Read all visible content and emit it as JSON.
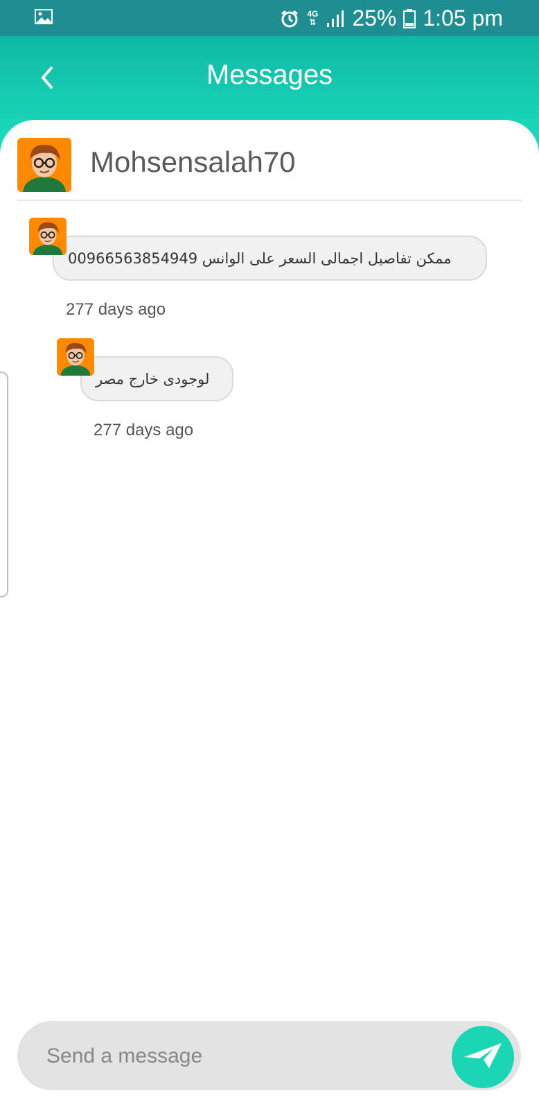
{
  "status_bar": {
    "battery": "25%",
    "time": "1:05 pm",
    "network": "4G",
    "icons": [
      "gallery-icon",
      "alarm-icon",
      "data-4g-icon",
      "signal-icon",
      "battery-icon"
    ]
  },
  "header": {
    "title": "Messages",
    "back_icon": "chevron-left-icon"
  },
  "contact": {
    "name": "Mohsensalah70"
  },
  "messages": [
    {
      "text": "ممكن تفاصيل  اجمالى السعر  على الوانس 00966563854949",
      "time": "277 days ago"
    },
    {
      "text": "لوجودى خارج مصر",
      "time": "277 days ago"
    }
  ],
  "composer": {
    "placeholder": "Send a message",
    "send_icon": "paper-plane-icon"
  },
  "colors": {
    "status_bar": "#1f8e92",
    "header_top": "#0fb9a3",
    "header_bottom": "#1de0c0",
    "send_button": "#1ad6b5",
    "bubble": "#f1f1f1"
  }
}
